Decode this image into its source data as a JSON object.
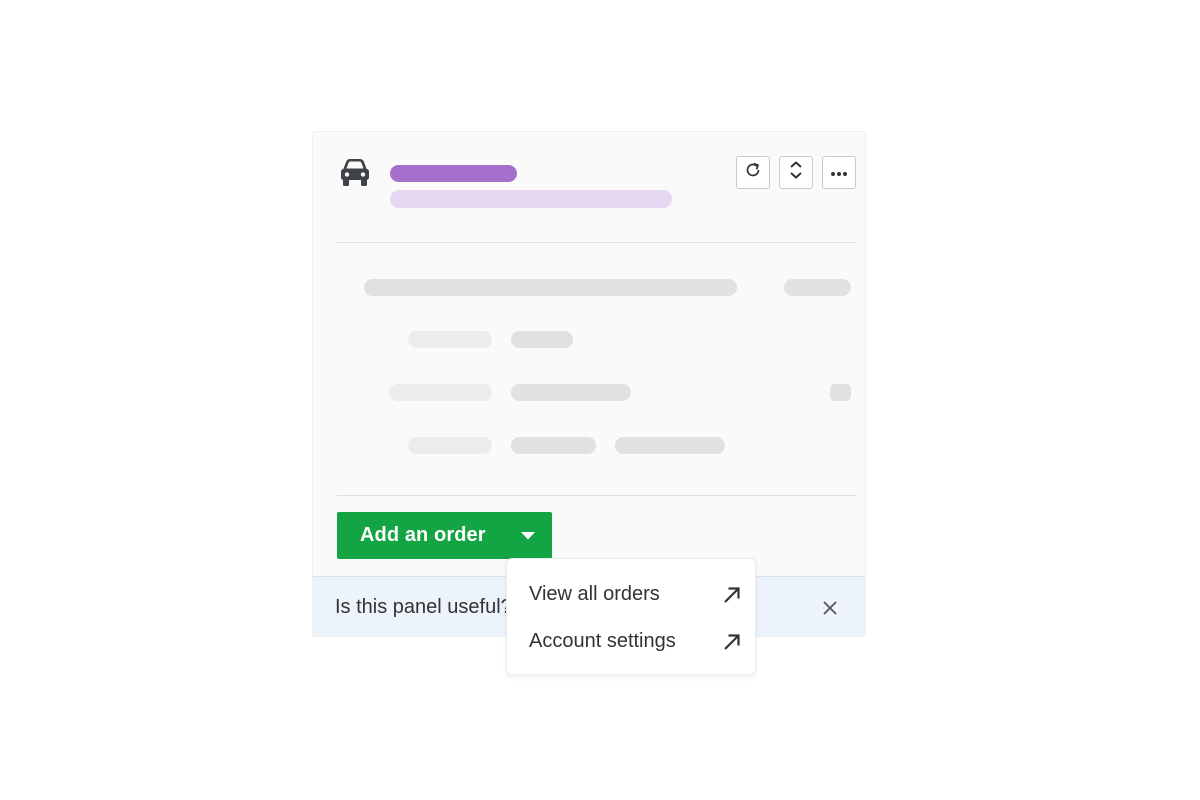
{
  "panel": {
    "icon": "car-icon",
    "colors": {
      "title_placeholder": "#a470cc",
      "subtitle_placeholder": "#e7d7f2",
      "skeleton_dark": "#e1e1e1",
      "skeleton_light": "#ececec",
      "accent_green": "#13a543",
      "feedback_bg": "#edf3fb"
    },
    "header_buttons": [
      {
        "name": "refresh-button",
        "icon": "refresh-icon"
      },
      {
        "name": "expand-collapse-button",
        "icon": "chevron-up-down-icon"
      },
      {
        "name": "more-options-button",
        "icon": "ellipsis-icon"
      }
    ]
  },
  "actions": {
    "add_order_label": "Add an order",
    "dropdown_icon": "caret-down-icon"
  },
  "feedback": {
    "question": "Is this panel useful?",
    "close_icon": "close-icon"
  },
  "menu": {
    "items": [
      {
        "label": "View all orders",
        "icon": "external-arrow-icon"
      },
      {
        "label": "Account settings",
        "icon": "external-arrow-icon"
      }
    ]
  }
}
